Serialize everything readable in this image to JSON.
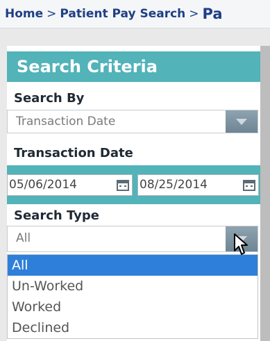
{
  "breadcrumb": {
    "home": "Home",
    "separator": ">",
    "patient_pay_search": "Patient Pay Search",
    "current": "Pa"
  },
  "search_panel": {
    "title": "Search Criteria",
    "search_by": {
      "label": "Search By",
      "value": "Transaction Date"
    },
    "transaction_date": {
      "label": "Transaction Date",
      "from": "05/06/2014",
      "to": "08/25/2014"
    },
    "search_type": {
      "label": "Search Type",
      "value": "All",
      "options": [
        "All",
        "Un-Worked",
        "Worked",
        "Declined"
      ],
      "selected_index": 0
    }
  },
  "colors": {
    "header_teal": "#52b3b9",
    "link_blue": "#1f3f86",
    "selected_option": "#2e7fd9"
  }
}
